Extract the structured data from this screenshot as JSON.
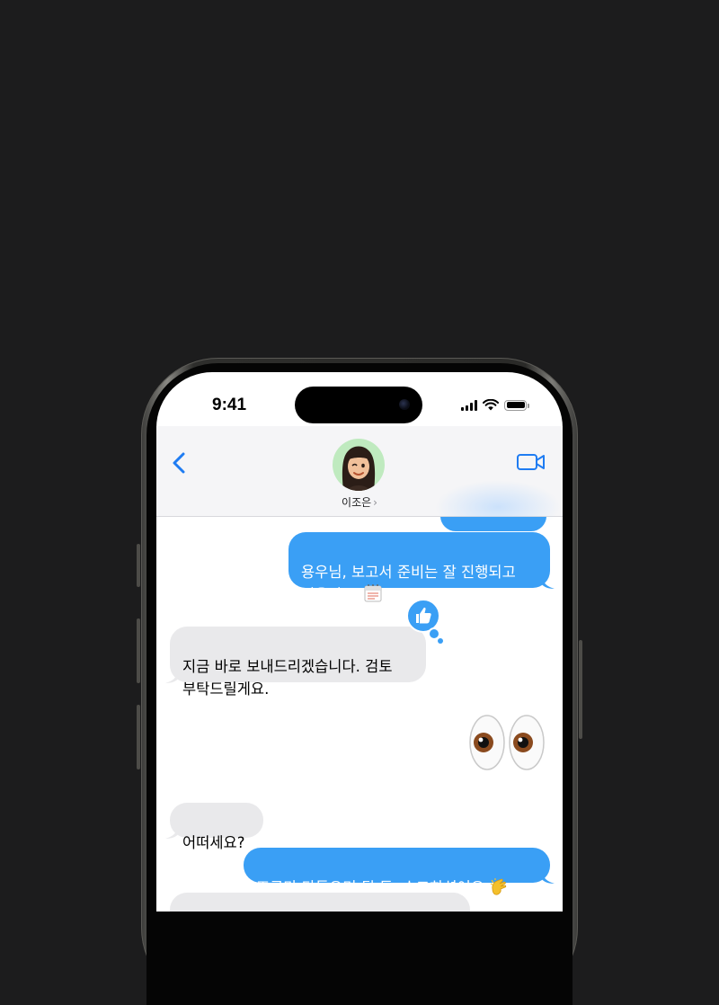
{
  "status_bar": {
    "time": "9:41"
  },
  "header": {
    "contact_name": "이조은",
    "contact_chevron": "›"
  },
  "icons": {
    "back": "chevron-left-icon",
    "video": "video-camera-icon",
    "reaction": "thumbs-up-icon",
    "calendar": "calendar-emoji",
    "eyes": "eyes-emoji",
    "clap": "clapping-hands-emoji"
  },
  "colors": {
    "accent": "#3a9ff5",
    "incoming": "#e9e9eb",
    "ios_blue": "#1f7cf2",
    "header_bg": "#f5f5f7"
  },
  "messages": [
    {
      "direction": "outgoing",
      "text": "용우님, 보고서 준비는 잘 진행되고\n있을까요?",
      "emoji": "calendar"
    },
    {
      "direction": "incoming",
      "text": "지금 바로 보내드리겠습니다. 검토\n부탁드릴게요.",
      "reaction": "thumbs-up"
    },
    {
      "direction": "outgoing",
      "emoji_only": "eyes"
    },
    {
      "direction": "incoming",
      "text": "어떠세요?"
    },
    {
      "direction": "outgoing",
      "text": "조금만 다듬으면 될 듯. 수고하셨어요.",
      "emoji": "clap"
    }
  ]
}
